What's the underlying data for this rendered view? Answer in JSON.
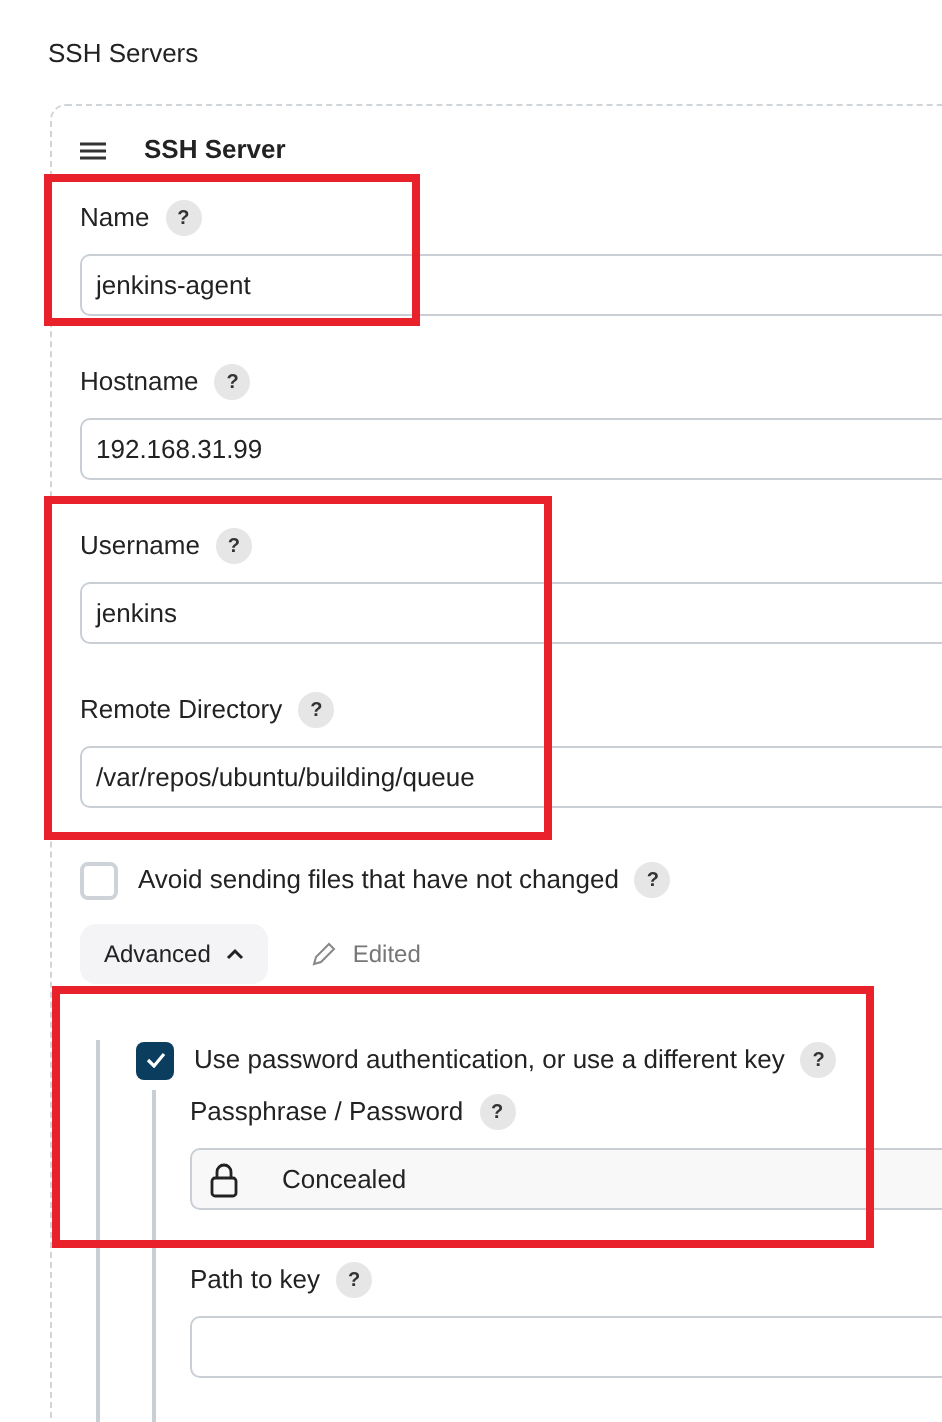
{
  "section_title": "SSH Servers",
  "server": {
    "title": "SSH Server",
    "fields": [
      {
        "label": "Name",
        "help": "?",
        "value": "jenkins-agent"
      },
      {
        "label": "Hostname",
        "help": "?",
        "value": "192.168.31.99"
      },
      {
        "label": "Username",
        "help": "?",
        "value": "jenkins"
      },
      {
        "label": "Remote Directory",
        "help": "?",
        "value": "/var/repos/ubuntu/building/queue"
      }
    ],
    "avoid_unchanged": {
      "label": "Avoid sending files that have not changed",
      "help": "?",
      "checked": false
    },
    "advanced": {
      "label": "Advanced",
      "expanded": true,
      "edited_label": "Edited"
    },
    "password_auth": {
      "label": "Use password authentication, or use a different key",
      "help": "?",
      "checked": true,
      "passphrase": {
        "label": "Passphrase / Password",
        "help": "?",
        "value": "Concealed"
      },
      "key_path": {
        "label": "Path to key",
        "help": "?"
      }
    }
  },
  "annotations": [
    {
      "kind": "red-box"
    },
    {
      "kind": "red-box"
    },
    {
      "kind": "red-box"
    }
  ]
}
